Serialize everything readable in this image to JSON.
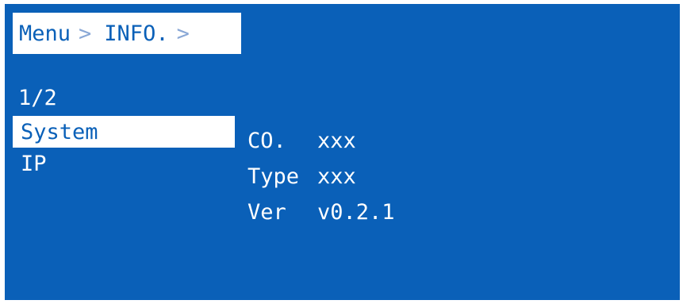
{
  "breadcrumb": {
    "items": [
      "Menu",
      "INFO."
    ],
    "separator": ">"
  },
  "page_indicator": "1/2",
  "menu": {
    "items": [
      {
        "label": "System",
        "selected": true
      },
      {
        "label": "IP",
        "selected": false
      }
    ]
  },
  "info": {
    "rows": [
      {
        "key": "CO.",
        "value": "xxx"
      },
      {
        "key": "Type",
        "value": "xxx"
      },
      {
        "key": "Ver",
        "value": "v0.2.1"
      }
    ]
  },
  "colors": {
    "background": "#0a60b8",
    "highlight": "#ffffff",
    "text": "#ffffff",
    "separator": "#8aa8d6"
  }
}
